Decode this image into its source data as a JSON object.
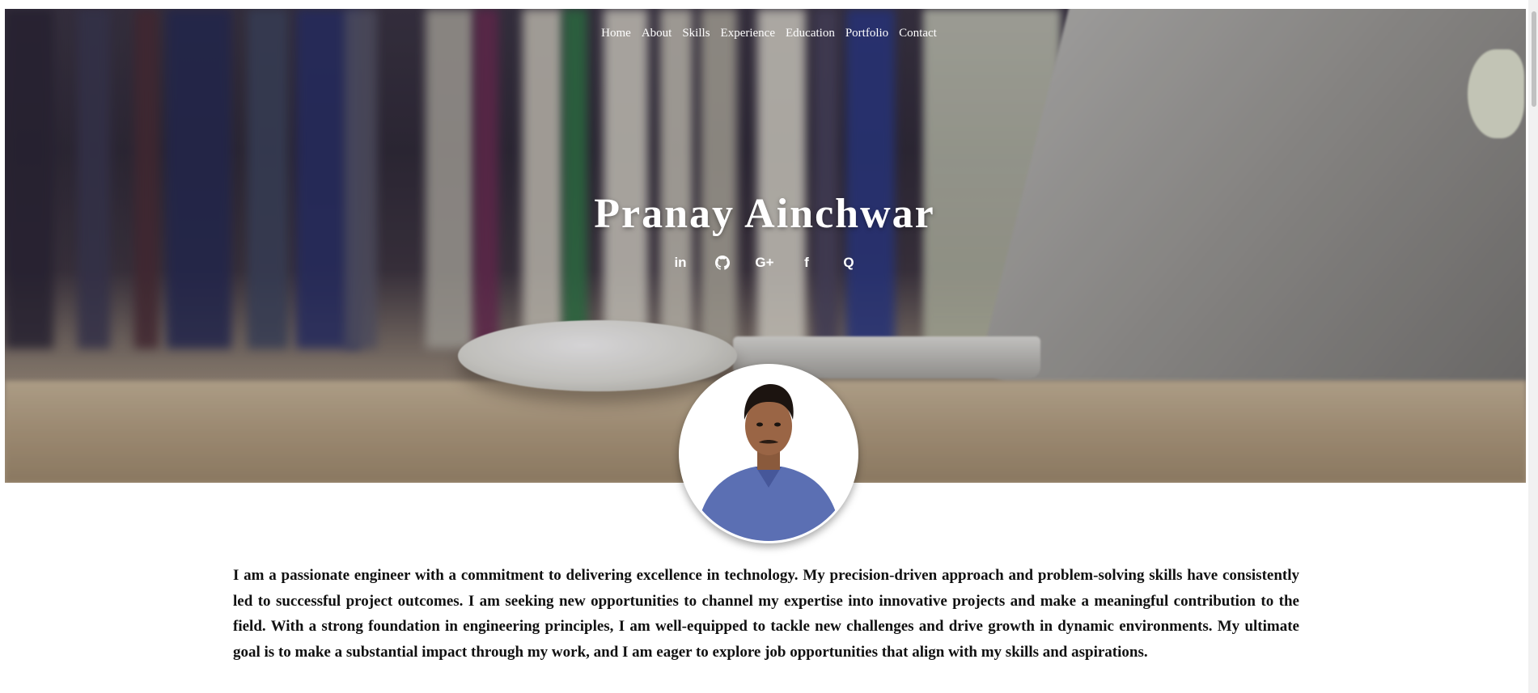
{
  "nav": {
    "items": [
      "Home",
      "About",
      "Skills",
      "Experience",
      "Education",
      "Portfolio",
      "Contact"
    ]
  },
  "hero": {
    "name": "Pranay Ainchwar"
  },
  "socials": [
    {
      "icon": "linkedin-icon",
      "glyph": "in"
    },
    {
      "icon": "github-icon",
      "glyph": ""
    },
    {
      "icon": "google-plus-icon",
      "glyph": "G+"
    },
    {
      "icon": "facebook-icon",
      "glyph": "f"
    },
    {
      "icon": "quora-icon",
      "glyph": "Q"
    }
  ],
  "about": {
    "text": "I am a passionate engineer with a commitment to delivering excellence in technology. My precision-driven approach and problem-solving skills have consistently led to successful project outcomes. I am seeking new opportunities to channel my expertise into innovative projects and make a meaningful contribution to the field. With a strong foundation in engineering principles, I am well-equipped to tackle new challenges and drive growth in dynamic environments. My ultimate goal is to make a substantial impact through my work, and I am eager to explore job opportunities that align with my skills and aspirations."
  },
  "colors": {
    "text": "#111111",
    "nav_text": "#ffffff",
    "shirt": "#5b6fb3"
  }
}
